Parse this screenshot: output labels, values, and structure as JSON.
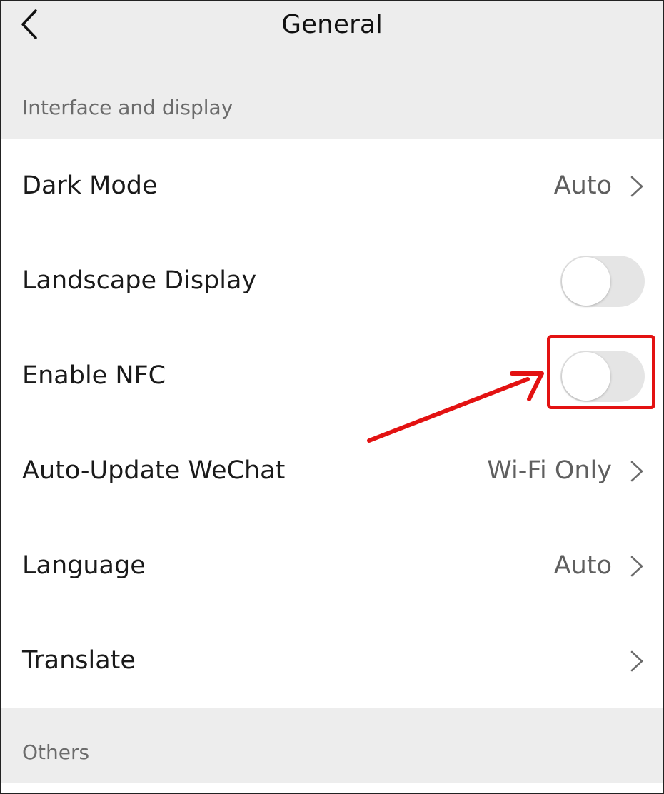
{
  "header": {
    "title": "General",
    "back_icon": "chevron-left-icon"
  },
  "sections": {
    "interface": "Interface and display",
    "others": "Others"
  },
  "rows": [
    {
      "label": "Dark Mode",
      "value": "Auto",
      "type": "chevron"
    },
    {
      "label": "Landscape Display",
      "type": "toggle",
      "on": false
    },
    {
      "label": "Enable NFC",
      "type": "toggle",
      "on": false
    },
    {
      "label": "Auto-Update WeChat",
      "value": "Wi-Fi Only",
      "type": "chevron"
    },
    {
      "label": "Language",
      "value": "Auto",
      "type": "chevron"
    },
    {
      "label": "Translate",
      "value": "",
      "type": "chevron"
    }
  ],
  "annotation": {
    "color": "#e31212"
  },
  "colors": {
    "background": "#ededed",
    "list_background": "#ffffff",
    "toggle_off": "#e5e5e5"
  }
}
